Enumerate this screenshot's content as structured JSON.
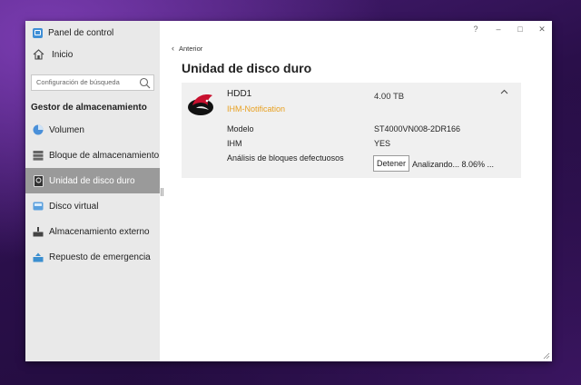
{
  "app": {
    "title": "Panel de control"
  },
  "window_controls": {
    "help": "?",
    "minimize": "–",
    "maximize": "□",
    "close": "✕"
  },
  "sidebar": {
    "home_label": "Inicio",
    "search_placeholder": "Configuración de búsqueda",
    "section_title": "Gestor de almacenamiento",
    "items": [
      {
        "label": "Volumen",
        "icon": "volume-icon",
        "active": false
      },
      {
        "label": "Bloque de almacenamiento",
        "icon": "storage-pool-icon",
        "active": false
      },
      {
        "label": "Unidad de disco duro",
        "icon": "hdd-icon",
        "active": true
      },
      {
        "label": "Disco virtual",
        "icon": "virtual-disk-icon",
        "active": false
      },
      {
        "label": "Almacenamiento externo",
        "icon": "external-storage-icon",
        "active": false
      },
      {
        "label": "Repuesto de emergencia",
        "icon": "hot-spare-icon",
        "active": false
      }
    ]
  },
  "main": {
    "back_label": "Anterior",
    "title": "Unidad de disco duro",
    "drive": {
      "name": "HDD1",
      "capacity": "4.00 TB",
      "notification": "IHM-Notification",
      "fields": [
        {
          "label": "Modelo",
          "value": "ST4000VN008-2DR166"
        },
        {
          "label": "IHM",
          "value": "YES"
        },
        {
          "label": "Análisis de bloques defectuosos",
          "value": ""
        }
      ],
      "stop_button": "Detener",
      "analyzing_text": "Analizando... 8.06% ..."
    }
  },
  "colors": {
    "accent_notification": "#e8a020",
    "sidebar_active": "#9a9a9a",
    "app_icon": "#3f8fd6"
  }
}
